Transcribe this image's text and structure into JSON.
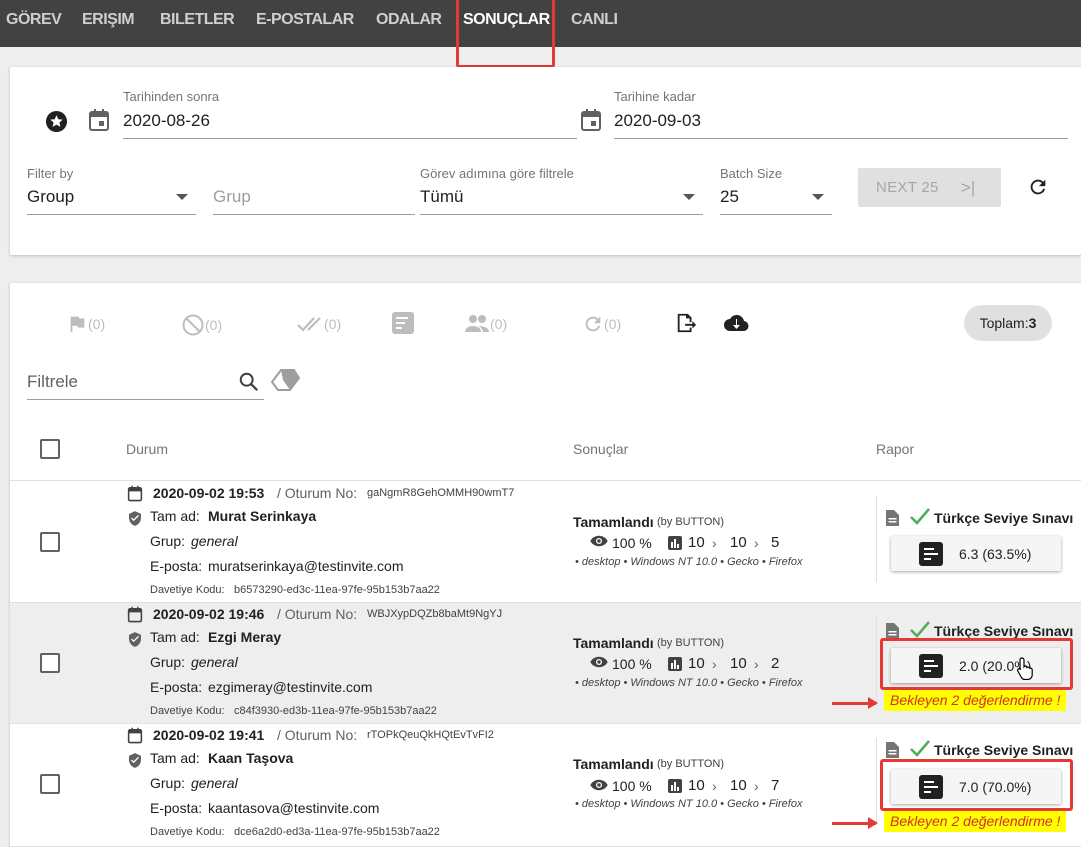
{
  "nav": {
    "tabs": [
      {
        "label": "GÖREV"
      },
      {
        "label": "ERIŞIM"
      },
      {
        "label": "BILETLER"
      },
      {
        "label": "E-POSTALAR"
      },
      {
        "label": "ODALAR"
      },
      {
        "label": "SONUÇLAR",
        "active": true
      },
      {
        "label": "CANLI"
      }
    ]
  },
  "filters": {
    "date_after": {
      "label": "Tarihinden sonra",
      "value": "2020-08-26"
    },
    "date_before": {
      "label": "Tarihine kadar",
      "value": "2020-09-03"
    },
    "filter_by": {
      "label": "Filter by",
      "value": "Group"
    },
    "group": {
      "placeholder": "Grup"
    },
    "task_step": {
      "label": "Görev adımına göre filtrele",
      "value": "Tümü"
    },
    "batch": {
      "label": "Batch Size",
      "value": "25"
    },
    "next_button": {
      "label": "NEXT 25",
      "icon_text": ">|"
    }
  },
  "toolbar": {
    "counts": [
      "(0)",
      "(0)",
      "(0)",
      "(0)",
      "(0)"
    ],
    "total_label": "Toplam:",
    "total_value": "3",
    "filter_placeholder": "Filtrele"
  },
  "table": {
    "headers": {
      "status": "Durum",
      "results": "Sonuçlar",
      "report": "Rapor"
    },
    "labels": {
      "session": "/ Oturum No:",
      "name": "Tam ad:",
      "group": "Grup:",
      "email": "E-posta:",
      "invite": "Davetiye Kodu:",
      "completed": "Tamamlandı",
      "by": "(by BUTTON)",
      "percent": "100 %",
      "env": "• desktop • Windows NT 10.0 • Gecko • Firefox",
      "exam": "Türkçe Seviye Sınavı",
      "pending": "Bekleyen 2 değerlendirme !"
    },
    "rows": [
      {
        "datetime": "2020-09-02 19:53",
        "session": "gaNgmR8GehOMMH90wmT7",
        "name": "Murat Serinkaya",
        "group": "general",
        "email": "muratserinkaya@testinvite.com",
        "invite": "b6573290-ed3c-11ea-97fe-95b153b7aa22",
        "q1": "10",
        "q2": "10",
        "q3": "5",
        "score": "6.3 (63.5%)"
      },
      {
        "datetime": "2020-09-02 19:46",
        "session": "WBJXypDQZb8baMt9NgYJ",
        "name": "Ezgi Meray",
        "group": "general",
        "email": "ezgimeray@testinvite.com",
        "invite": "c84f3930-ed3b-11ea-97fe-95b153b7aa22",
        "q1": "10",
        "q2": "10",
        "q3": "2",
        "score": "2.0 (20.0%)"
      },
      {
        "datetime": "2020-09-02 19:41",
        "session": "rTOPkQeuQkHQtEvTvFI2",
        "name": "Kaan Taşova",
        "group": "general",
        "email": "kaantasova@testinvite.com",
        "invite": "dce6a2d0-ed3a-11ea-97fe-95b153b7aa22",
        "q1": "10",
        "q2": "10",
        "q3": "7",
        "score": "7.0 (70.0%)"
      }
    ]
  },
  "colors": {
    "highlight": "#e53935",
    "pending_bg": "#ffff00",
    "check": "#4caf50",
    "nav_bg": "#424242"
  }
}
